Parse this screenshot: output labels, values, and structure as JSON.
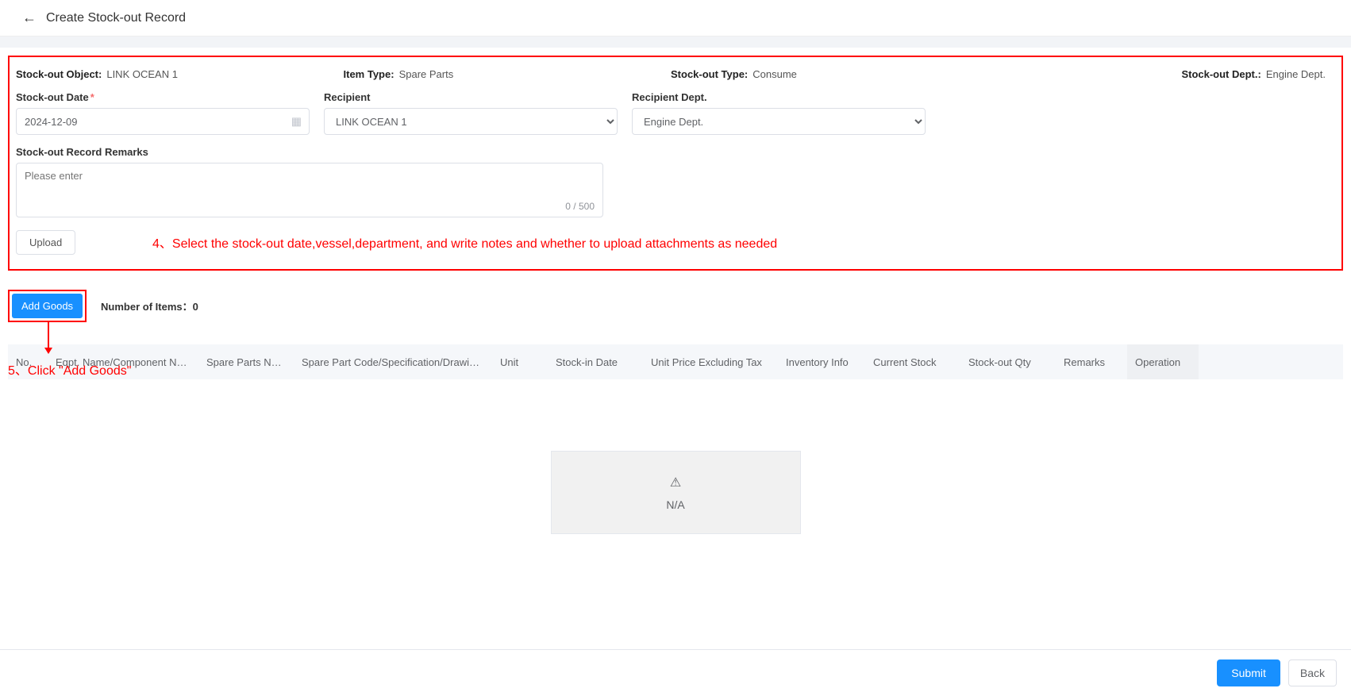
{
  "header": {
    "title": "Create Stock-out Record"
  },
  "form": {
    "stockout_object_label": "Stock-out Object:",
    "stockout_object_value": "LINK OCEAN 1",
    "item_type_label": "Item Type:",
    "item_type_value": "Spare Parts",
    "stockout_type_label": "Stock-out Type:",
    "stockout_type_value": "Consume",
    "stockout_dept_label": "Stock-out Dept.:",
    "stockout_dept_value": "Engine Dept.",
    "date_label": "Stock-out Date",
    "date_value": "2024-12-09",
    "recipient_label": "Recipient",
    "recipient_value": "LINK OCEAN 1",
    "recipient_dept_label": "Recipient Dept.",
    "recipient_dept_value": "Engine Dept.",
    "remarks_label": "Stock-out Record Remarks",
    "remarks_placeholder": "Please enter",
    "remarks_count": "0 / 500",
    "upload_label": "Upload"
  },
  "annotations": {
    "step4": "4、Select the stock-out date,vessel,department, and write notes and whether to upload attachments as needed",
    "step5": "5、Click \"Add Goods\""
  },
  "goods": {
    "add_button": "Add Goods",
    "count_label": "Number of Items：",
    "count_value": "0"
  },
  "table": {
    "headers": {
      "no": "No.",
      "eqpt": "Eqpt. Name/Component Name",
      "spare_name": "Spare Parts Name",
      "spare_code": "Spare Part Code/Specification/Drawing …",
      "unit": "Unit",
      "stockin_date": "Stock-in Date",
      "unit_price": "Unit Price Excluding Tax",
      "inventory": "Inventory Info",
      "current_stock": "Current Stock",
      "stockout_qty": "Stock-out Qty",
      "remarks": "Remarks",
      "operation": "Operation"
    },
    "empty": "N/A"
  },
  "footer": {
    "submit": "Submit",
    "back": "Back"
  }
}
